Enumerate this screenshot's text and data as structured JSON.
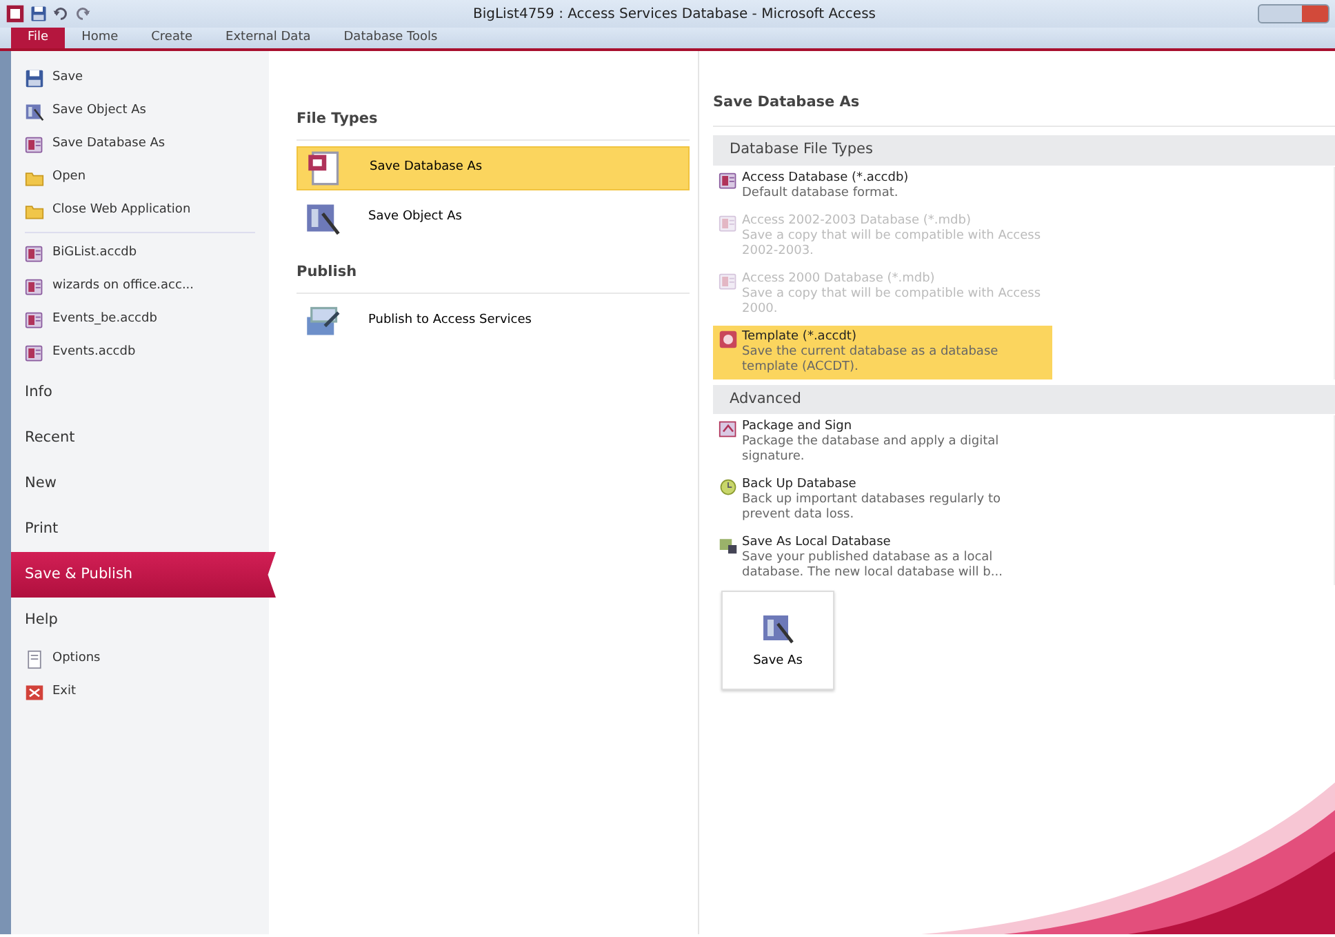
{
  "window": {
    "title": "BigList4759 : Access Services Database  -  Microsoft Access"
  },
  "ribbon_tabs": [
    {
      "label": "File",
      "selected": true
    },
    {
      "label": "Home",
      "selected": false
    },
    {
      "label": "Create",
      "selected": false
    },
    {
      "label": "External Data",
      "selected": false
    },
    {
      "label": "Database Tools",
      "selected": false
    }
  ],
  "backstage_menu": [
    {
      "kind": "command",
      "label": "Save"
    },
    {
      "kind": "command",
      "label": "Save Object As"
    },
    {
      "kind": "command",
      "label": "Save Database As"
    },
    {
      "kind": "command",
      "label": "Open"
    },
    {
      "kind": "command",
      "label": "Close Web Application"
    },
    {
      "kind": "recent",
      "label": "BiGList.accdb"
    },
    {
      "kind": "recent",
      "label": "wizards on office.acc..."
    },
    {
      "kind": "recent",
      "label": "Events_be.accdb"
    },
    {
      "kind": "recent",
      "label": "Events.accdb"
    },
    {
      "kind": "tab",
      "label": "Info",
      "selected": false
    },
    {
      "kind": "tab",
      "label": "Recent",
      "selected": false
    },
    {
      "kind": "tab",
      "label": "New",
      "selected": false
    },
    {
      "kind": "tab",
      "label": "Print",
      "selected": false
    },
    {
      "kind": "tab",
      "label": "Save & Publish",
      "selected": true
    },
    {
      "kind": "tab",
      "label": "Help",
      "selected": false
    },
    {
      "kind": "command",
      "label": "Options"
    },
    {
      "kind": "command",
      "label": "Exit"
    }
  ],
  "file_types": {
    "sections": [
      {
        "title": "File Types",
        "items": [
          {
            "label": "Save Database As",
            "selected": true
          },
          {
            "label": "Save Object As",
            "selected": false
          }
        ]
      },
      {
        "title": "Publish",
        "items": [
          {
            "label": "Publish to Access Services",
            "selected": false
          }
        ]
      }
    ]
  },
  "save_database_as": {
    "title": "Save Database As",
    "groups": [
      {
        "title": "Database File Types",
        "items": [
          {
            "label": "Access Database (*.accdb)",
            "description": "Default database format.",
            "disabled": false,
            "selected": false
          },
          {
            "label": "Access 2002-2003 Database (*.mdb)",
            "description": "Save a copy that will be compatible with Access 2002-2003.",
            "disabled": true,
            "selected": false
          },
          {
            "label": "Access 2000 Database (*.mdb)",
            "description": "Save a copy that will be compatible with Access 2000.",
            "disabled": true,
            "selected": false
          },
          {
            "label": "Template (*.accdt)",
            "description": "Save the current database as a database template (ACCDT).",
            "disabled": false,
            "selected": true
          }
        ]
      },
      {
        "title": "Advanced",
        "items": [
          {
            "label": "Package and Sign",
            "description": "Package the database and apply a digital signature.",
            "disabled": false,
            "selected": false
          },
          {
            "label": "Back Up Database",
            "description": "Back up important databases regularly to prevent data loss.",
            "disabled": false,
            "selected": false
          },
          {
            "label": "Save As Local Database",
            "description": "Save your published database as a local database. The new local database will b...",
            "disabled": false,
            "selected": false
          }
        ]
      }
    ],
    "button": "Save As"
  }
}
